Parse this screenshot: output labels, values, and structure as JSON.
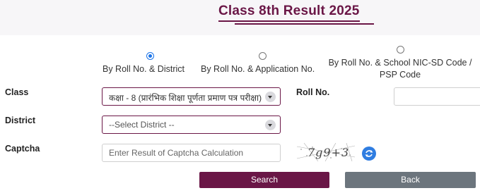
{
  "page": {
    "title": "Class 8th Result 2025"
  },
  "search_options": [
    {
      "label": "By Roll No. & District",
      "selected": true
    },
    {
      "label": "By Roll No. & Application No.",
      "selected": false
    },
    {
      "label": "By Roll No. & School NIC-SD Code / PSP Code",
      "selected": false
    }
  ],
  "form": {
    "class_label": "Class",
    "class_value": "कक्षा - 8 (प्रारंभिक शिक्षा पूर्णता प्रमाण पत्र परीक्षा)",
    "roll_label": "Roll No.",
    "roll_value": "",
    "district_label": "District",
    "district_value": "--Select District --",
    "captcha_label": "Captcha",
    "captcha_placeholder": "Enter Result of Captcha Calculation",
    "captcha_text": "7g9+3"
  },
  "buttons": {
    "search": "Search",
    "back": "Back"
  },
  "colors": {
    "accent": "#6a1646",
    "back": "#6c757d",
    "refresh": "#2f7de1",
    "radio": "#1a73e8"
  },
  "icons": {
    "refresh": "refresh-icon",
    "dropdown": "chevron-down-icon"
  }
}
